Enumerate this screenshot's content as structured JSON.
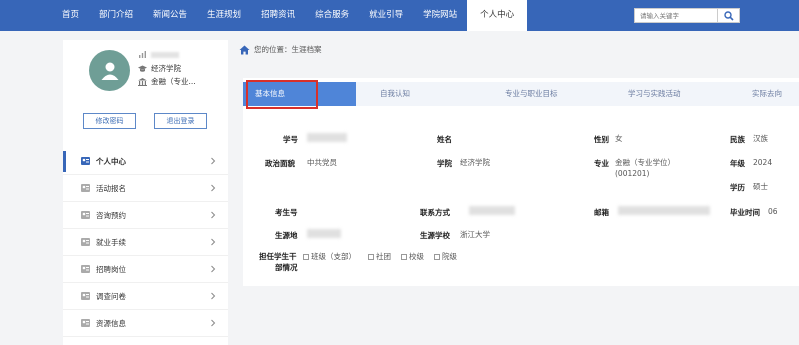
{
  "nav": {
    "items": [
      "首页",
      "部门介绍",
      "新闻公告",
      "生涯规划",
      "招聘资讯",
      "综合服务",
      "就业引导",
      "学院网站",
      "个人中心"
    ],
    "active": "个人中心",
    "search_placeholder": "请输入关键字"
  },
  "profile": {
    "name": "",
    "college": "经济学院",
    "major": "金融（专业..."
  },
  "sidebar_buttons": {
    "change_password": "修改密码",
    "logout": "退出登录"
  },
  "menu": [
    {
      "label": "个人中心",
      "active": true
    },
    {
      "label": "活动报名"
    },
    {
      "label": "咨询预约"
    },
    {
      "label": "就业手续"
    },
    {
      "label": "招聘岗位"
    },
    {
      "label": "调查问卷"
    },
    {
      "label": "资源信息"
    }
  ],
  "breadcrumb": "您的位置：生涯档案",
  "tabs": [
    "基本信息",
    "自我认知",
    "专业与职业目标",
    "学习与实践活动",
    "实际去向"
  ],
  "info": {
    "labels": {
      "student_id": "学号",
      "name": "姓名",
      "gender": "性别",
      "ethnicity": "民族",
      "political": "政治面貌",
      "college": "学院",
      "major": "专业",
      "grade": "年级",
      "education": "学历",
      "exam_no": "考生号",
      "contact": "联系方式",
      "email": "邮箱",
      "grad_time": "毕业时间",
      "origin": "生源地",
      "origin_school": "生源学校",
      "cadre_line1": "担任学生干",
      "cadre_line2": "部情况"
    },
    "values": {
      "gender": "女",
      "ethnicity": "汉族",
      "political": "中共党员",
      "college": "经济学院",
      "major_line1": "金融（专业学位）",
      "major_line2": "(001201)",
      "grade": "2024",
      "education": "硕士",
      "grad_time": "06",
      "origin_school": "浙江大学"
    },
    "cadre_options": [
      "班级（支部）",
      "社团",
      "校级",
      "院级"
    ]
  },
  "colors": {
    "nav": "#3766b8",
    "tab_active": "#4f85d8",
    "highlight": "#d8302a",
    "avatar": "#6f9e96"
  }
}
